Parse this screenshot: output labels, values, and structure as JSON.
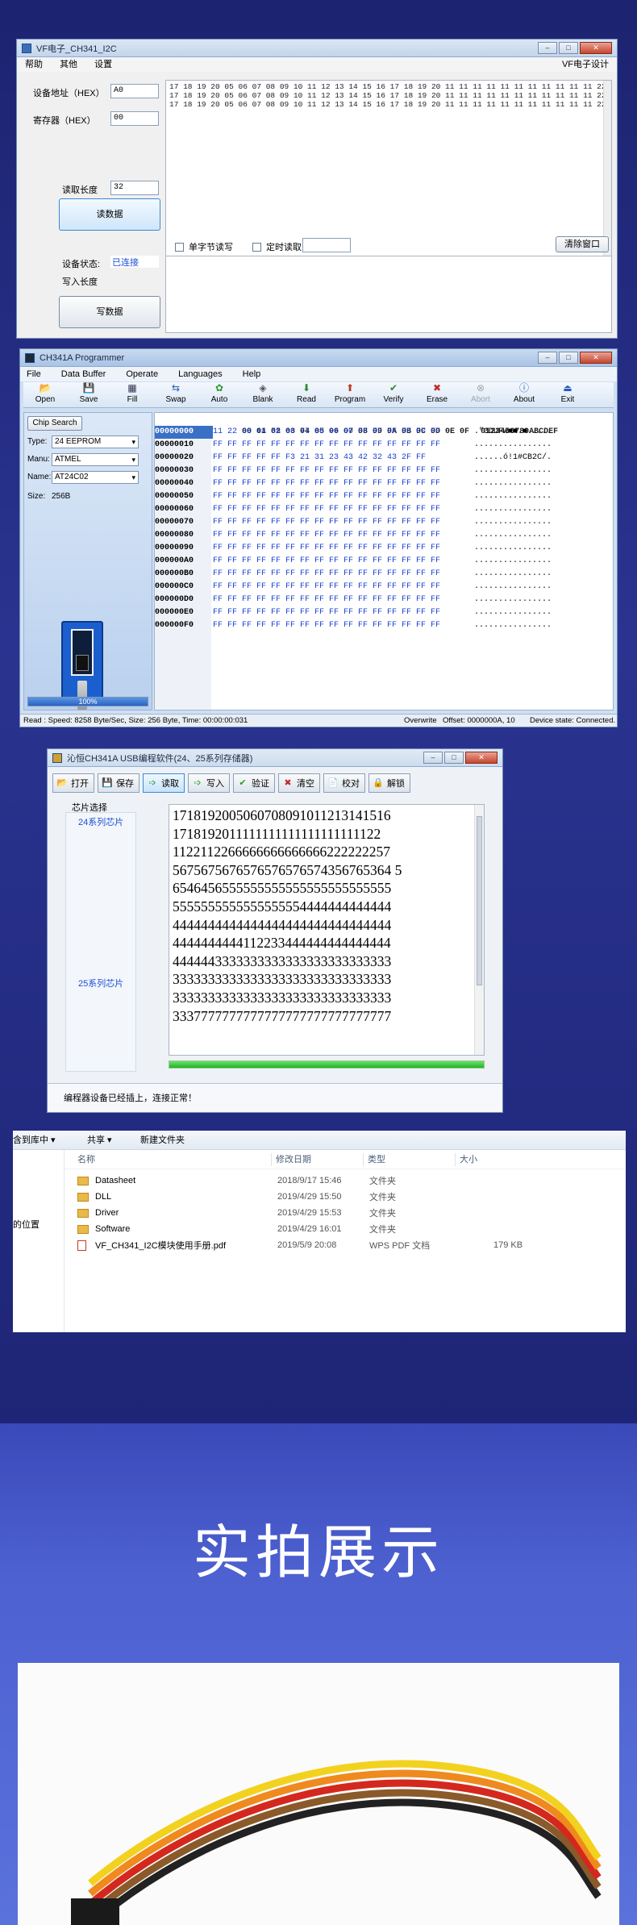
{
  "w1": {
    "title": "VF电子_CH341_I2C",
    "menu": [
      "帮助",
      "其他",
      "设置"
    ],
    "brand": "VF电子设计",
    "addr_label": "设备地址（HEX）",
    "addr_value": "A0",
    "reg_label": "寄存器（HEX）",
    "reg_value": "00",
    "readlen_label": "读取长度",
    "readlen_value": "32",
    "read_btn": "读数据",
    "hex_lines": [
      "17 18 19 20 05 06 07 08 09 10 11 12 13 14 15 16 17 18 19 20 11 11 11 11 11 11 11 11 11 11 11 22",
      "17 18 19 20 05 06 07 08 09 10 11 12 13 14 15 16 17 18 19 20 11 11 11 11 11 11 11 11 11 11 11 22",
      "17 18 19 20 05 06 07 08 09 10 11 12 13 14 15 16 17 18 19 20 11 11 11 11 11 11 11 11 11 11 11 22"
    ],
    "single_byte": "单字节读写",
    "timed_read": "定时读取",
    "clear_btn": "清除窗口",
    "status_label": "设备状态:",
    "status_value": "已连接",
    "writelen_label": "写入长度",
    "write_btn": "写数据"
  },
  "w2": {
    "title": "CH341A Programmer",
    "menu": [
      "File",
      "Data Buffer",
      "Operate",
      "Languages",
      "Help"
    ],
    "tools": [
      {
        "label": "Open",
        "glyph": "📂"
      },
      {
        "label": "Save",
        "glyph": "💾"
      },
      {
        "label": "Fill",
        "glyph": "▦"
      },
      {
        "label": "Swap",
        "glyph": "⇆"
      },
      {
        "label": "Auto",
        "glyph": "✿"
      },
      {
        "label": "Blank",
        "glyph": "◈"
      },
      {
        "label": "Read",
        "glyph": "⬇"
      },
      {
        "label": "Program",
        "glyph": "⬆"
      },
      {
        "label": "Verify",
        "glyph": "✔"
      },
      {
        "label": "Erase",
        "glyph": "✖"
      },
      {
        "label": "Abort",
        "glyph": "⊗"
      },
      {
        "label": "About",
        "glyph": "ⓘ"
      },
      {
        "label": "Exit",
        "glyph": "⏏"
      }
    ],
    "chip_search": "Chip Search",
    "type_label": "Type:",
    "type_value": "24 EEPROM",
    "manu_label": "Manu:",
    "manu_value": "ATMEL",
    "name_label": "Name:",
    "name_value": "AT24C02",
    "size_label": "Size:",
    "size_value": "256B",
    "progress_text": "100%",
    "progress": 1.0,
    "hex_header": "00 01 02 03 04 05 06 07 08 09 0A 0B 0C 0D 0E 0F",
    "ascii_header": "0123456789ABCDEF",
    "rows": [
      {
        "addr": "00000000",
        "hex": "11 22 33 44 55 66 77 88 99 00 FF FF FF FF FF FF",
        "ascii": ".\"3DUFw■■.■....."
      },
      {
        "addr": "00000010",
        "hex": "FF FF FF FF FF FF FF FF FF FF FF FF FF FF FF FF",
        "ascii": "................"
      },
      {
        "addr": "00000020",
        "hex": "FF FF FF FF FF F3 21 31 23 43 42 32 43 2F FF",
        "ascii": "......ó!1#CB2C/."
      },
      {
        "addr": "00000030",
        "hex": "FF FF FF FF FF FF FF FF FF FF FF FF FF FF FF FF",
        "ascii": "................"
      },
      {
        "addr": "00000040",
        "hex": "FF FF FF FF FF FF FF FF FF FF FF FF FF FF FF FF",
        "ascii": "................"
      },
      {
        "addr": "00000050",
        "hex": "FF FF FF FF FF FF FF FF FF FF FF FF FF FF FF FF",
        "ascii": "................"
      },
      {
        "addr": "00000060",
        "hex": "FF FF FF FF FF FF FF FF FF FF FF FF FF FF FF FF",
        "ascii": "................"
      },
      {
        "addr": "00000070",
        "hex": "FF FF FF FF FF FF FF FF FF FF FF FF FF FF FF FF",
        "ascii": "................"
      },
      {
        "addr": "00000080",
        "hex": "FF FF FF FF FF FF FF FF FF FF FF FF FF FF FF FF",
        "ascii": "................"
      },
      {
        "addr": "00000090",
        "hex": "FF FF FF FF FF FF FF FF FF FF FF FF FF FF FF FF",
        "ascii": "................"
      },
      {
        "addr": "000000A0",
        "hex": "FF FF FF FF FF FF FF FF FF FF FF FF FF FF FF FF",
        "ascii": "................"
      },
      {
        "addr": "000000B0",
        "hex": "FF FF FF FF FF FF FF FF FF FF FF FF FF FF FF FF",
        "ascii": "................"
      },
      {
        "addr": "000000C0",
        "hex": "FF FF FF FF FF FF FF FF FF FF FF FF FF FF FF FF",
        "ascii": "................"
      },
      {
        "addr": "000000D0",
        "hex": "FF FF FF FF FF FF FF FF FF FF FF FF FF FF FF FF",
        "ascii": "................"
      },
      {
        "addr": "000000E0",
        "hex": "FF FF FF FF FF FF FF FF FF FF FF FF FF FF FF FF",
        "ascii": "................"
      },
      {
        "addr": "000000F0",
        "hex": "FF FF FF FF FF FF FF FF FF FF FF FF FF FF FF FF",
        "ascii": "................"
      }
    ],
    "status_left": "Read : Speed: 8258 Byte/Sec, Size: 256 Byte, Time: 00:00:00:031",
    "status_mode": "Overwrite",
    "status_offset": "Offset: 0000000A, 10",
    "status_device": "Device state: Connected."
  },
  "w3": {
    "title": "沁恒CH341A USB编程软件(24、25系列存储器)",
    "buttons": [
      {
        "label": "打开",
        "glyph": "📂"
      },
      {
        "label": "保存",
        "glyph": "💾"
      },
      {
        "label": "读取",
        "glyph": "➩"
      },
      {
        "label": "写入",
        "glyph": "➩"
      },
      {
        "label": "验证",
        "glyph": "✔"
      },
      {
        "label": "清空",
        "glyph": "✖"
      },
      {
        "label": "校对",
        "glyph": "📄"
      },
      {
        "label": "解锁",
        "glyph": "🔒"
      }
    ],
    "chip_select": "芯片选择",
    "series24": "24系列芯片",
    "series25": "25系列芯片",
    "data_lines": [
      "1718192005060708091011213141516",
      "1718192011111111111111111111122",
      "1122112266666666666666222222257",
      "5675675676576576576574356765364 5",
      "6546456555555555555555555555555",
      "5555555555555555554444444444444",
      "4444444444444444444444444444444",
      "4444444444112233444444444444444",
      "4444443333333333333333333333333",
      "3333333333333333333333333333333",
      "3333333333333333333333333333333",
      "3337777777777777777777777777777"
    ],
    "progress": 1.0,
    "status": "编程器设备已经插上，连接正常！"
  },
  "w4": {
    "toolbar": [
      "含到库中 ▾",
      "共享 ▾",
      "新建文件夹"
    ],
    "col_name": "名称",
    "col_date": "修改日期",
    "col_type": "类型",
    "col_size": "大小",
    "side_text": "的位置",
    "files": [
      {
        "name": "Datasheet",
        "date": "2018/9/17 15:46",
        "type": "文件夹",
        "size": "",
        "kind": "folder"
      },
      {
        "name": "DLL",
        "date": "2019/4/29 15:50",
        "type": "文件夹",
        "size": "",
        "kind": "folder"
      },
      {
        "name": "Driver",
        "date": "2019/4/29 15:53",
        "type": "文件夹",
        "size": "",
        "kind": "folder"
      },
      {
        "name": "Software",
        "date": "2019/4/29 16:01",
        "type": "文件夹",
        "size": "",
        "kind": "folder"
      },
      {
        "name": "VF_CH341_I2C模块使用手册.pdf",
        "date": "2019/5/9 20:08",
        "type": "WPS PDF 文档",
        "size": "179 KB",
        "kind": "pdf"
      }
    ]
  },
  "section_title": "实拍展示",
  "colors": {
    "accent": "#5a72dc",
    "dark": "#1d2472"
  }
}
